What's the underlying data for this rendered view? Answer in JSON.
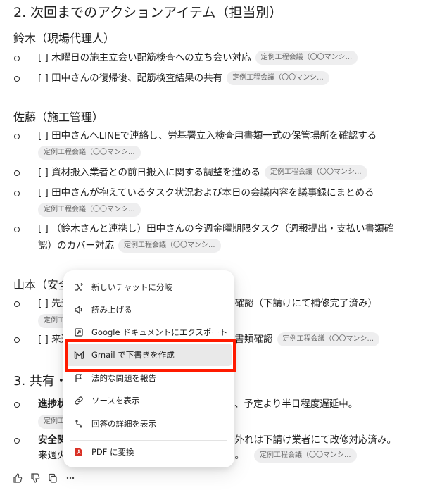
{
  "section2": {
    "heading": "2. 次回までのアクションアイテム（担当別）",
    "chip": "定例工程会議（〇〇マンシ...",
    "suzuki": {
      "name": "鈴木（現場代理人）",
      "items": [
        "[ ] 木曜日の施主立会い配筋検査への立ち会い対応",
        "[ ] 田中さんの復帰後、配筋検査結果の共有"
      ]
    },
    "sato": {
      "name": "佐藤（施工管理）",
      "items": [
        "[ ] 田中さんへLINEで連絡し、労基署立入検査用書類一式の保管場所を確認する",
        "[ ] 資材搬入業者との前日搬入に関する調整を進める",
        "[ ] 田中さんが抱えているタスク状況および本日の会議内容を議事録にまとめる",
        "[ ] （鈴木さんと連携し）田中さんの今週金曜期限タスク（週報提出・支払い書類確認）のカバー対応"
      ]
    },
    "yamamoto": {
      "name_visible": "山本（安全",
      "items_visible": [
        "[ ] 先週",
        "修確認（下請けにて補修完了済み）",
        "[ ] 来週",
        "・書類確認"
      ],
      "chip_visible": "定例工"
    }
  },
  "section3": {
    "heading_visible": "3. 共有・",
    "items_visible": [
      {
        "bold": "進捗状",
        "tail": "り、予定より半日程度遅延中。",
        "chip_visible": "定例工"
      },
      {
        "bold": "安全関",
        "tail": "の外れは下請け業者にて改修対応済み。",
        "line2": "来週火",
        "line2_tail": "る。"
      }
    ]
  },
  "context_menu": {
    "items": [
      {
        "label": "新しいチャットに分岐",
        "icon": "branch-icon"
      },
      {
        "label": "読み上げる",
        "icon": "speaker-icon"
      },
      {
        "label": "Google ドキュメントにエクスポート",
        "icon": "doc-export-icon"
      },
      {
        "label": "Gmail で下書きを作成",
        "icon": "gmail-icon",
        "highlighted": true
      },
      {
        "label": "法的な問題を報告",
        "icon": "flag-icon"
      },
      {
        "label": "ソースを表示",
        "icon": "link-icon"
      },
      {
        "label": "回答の詳細を表示",
        "icon": "details-icon"
      },
      {
        "label": "PDF に変換",
        "icon": "pdf-icon"
      }
    ]
  },
  "colors": {
    "highlight_box": "#ff1a00",
    "pdf_icon": "#d93025"
  },
  "toolbar": {
    "icons": [
      "thumbs-up-icon",
      "thumbs-down-icon",
      "copy-icon",
      "more-icon"
    ]
  }
}
